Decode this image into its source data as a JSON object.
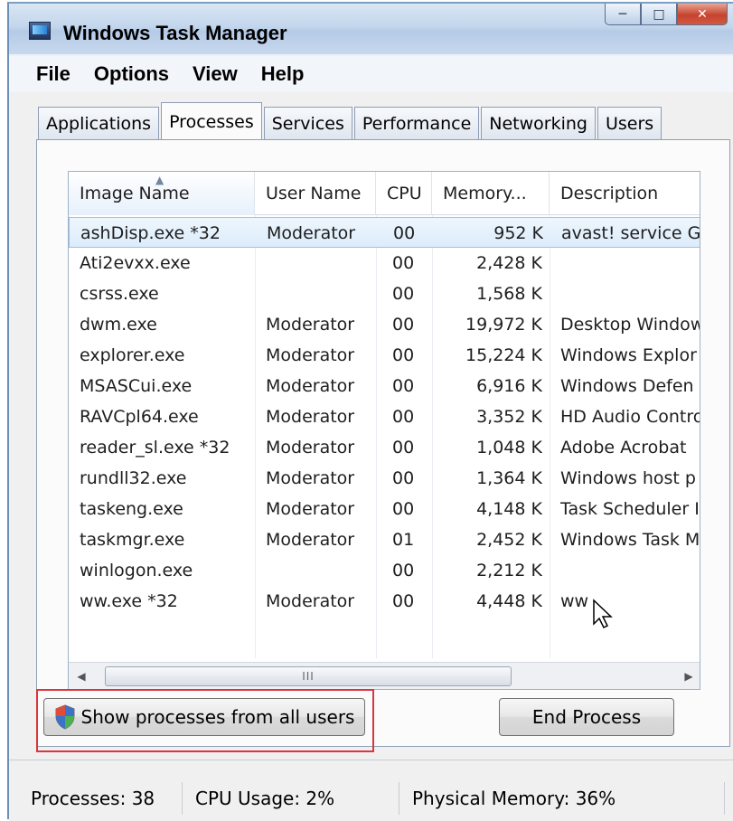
{
  "window": {
    "title": "Windows Task Manager"
  },
  "menu": [
    "File",
    "Options",
    "View",
    "Help"
  ],
  "tabs": [
    {
      "label": "Applications",
      "active": false
    },
    {
      "label": "Processes",
      "active": true
    },
    {
      "label": "Services",
      "active": false
    },
    {
      "label": "Performance",
      "active": false
    },
    {
      "label": "Networking",
      "active": false
    },
    {
      "label": "Users",
      "active": false
    }
  ],
  "columns": [
    "Image Name",
    "User Name",
    "CPU",
    "Memory...",
    "Description"
  ],
  "rows": [
    [
      "ashDisp.exe *32",
      "Moderator",
      "00",
      "952 K",
      "avast! service G"
    ],
    [
      "Ati2evxx.exe",
      "",
      "00",
      "2,428 K",
      ""
    ],
    [
      "csrss.exe",
      "",
      "00",
      "1,568 K",
      ""
    ],
    [
      "dwm.exe",
      "Moderator",
      "00",
      "19,972 K",
      "Desktop Window"
    ],
    [
      "explorer.exe",
      "Moderator",
      "00",
      "15,224 K",
      "Windows Explor"
    ],
    [
      "MSASCui.exe",
      "Moderator",
      "00",
      "6,916 K",
      "Windows Defen"
    ],
    [
      "RAVCpl64.exe",
      "Moderator",
      "00",
      "3,352 K",
      "HD Audio Contro"
    ],
    [
      "reader_sl.exe *32",
      "Moderator",
      "00",
      "1,048 K",
      "Adobe Acrobat"
    ],
    [
      "rundll32.exe",
      "Moderator",
      "00",
      "1,364 K",
      "Windows host p"
    ],
    [
      "taskeng.exe",
      "Moderator",
      "00",
      "4,148 K",
      "Task Scheduler I"
    ],
    [
      "taskmgr.exe",
      "Moderator",
      "01",
      "2,452 K",
      "Windows Task M"
    ],
    [
      "winlogon.exe",
      "",
      "00",
      "2,212 K",
      ""
    ],
    [
      "ww.exe *32",
      "Moderator",
      "00",
      "4,448 K",
      "ww"
    ]
  ],
  "selected_row": 0,
  "scrollbar": {
    "thumb_glyph": "III"
  },
  "buttons": {
    "show_all": "Show processes from all users",
    "end_process": "End Process"
  },
  "status": {
    "processes": "Processes: 38",
    "cpu": "CPU Usage: 2%",
    "memory": "Physical Memory: 36%"
  }
}
